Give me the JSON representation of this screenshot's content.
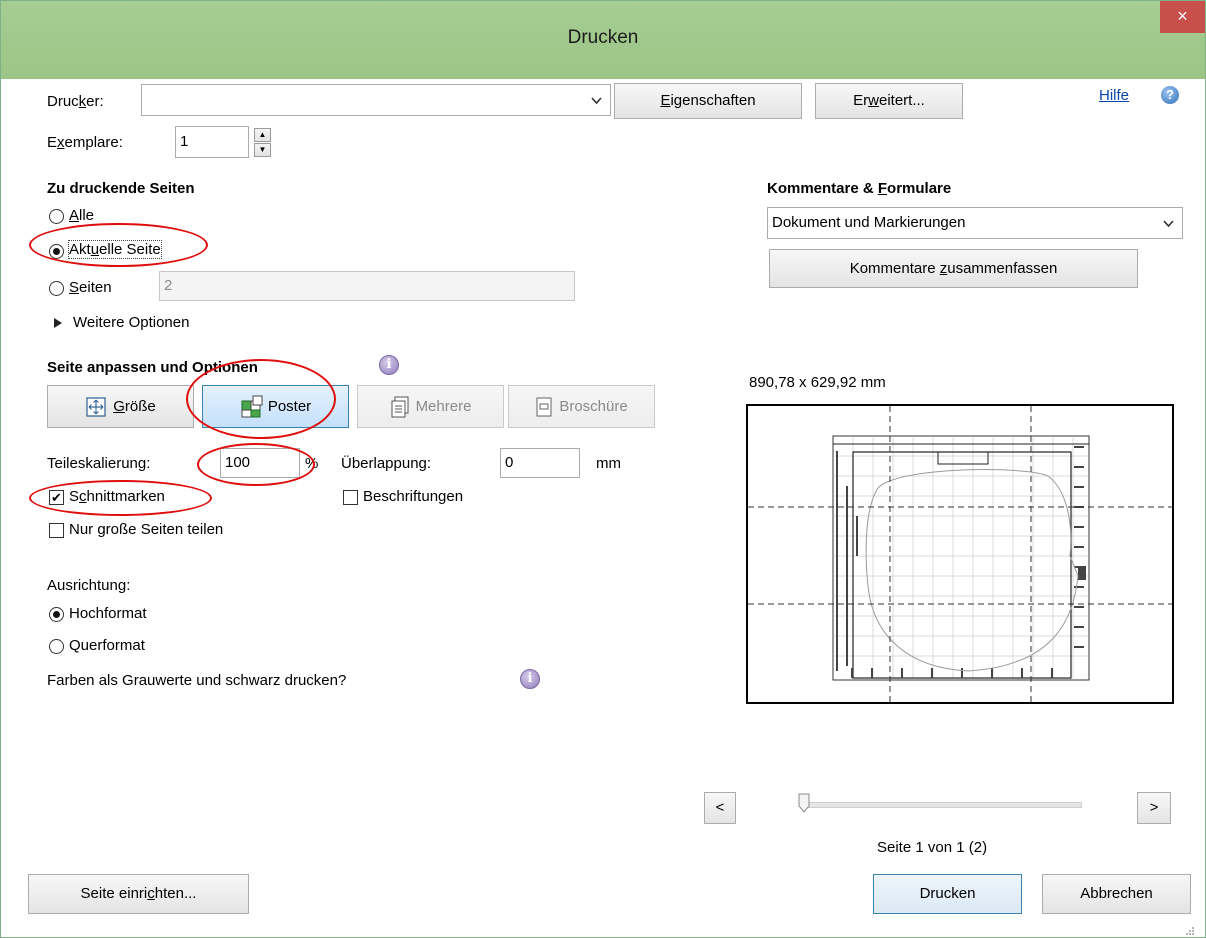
{
  "window": {
    "title": "Drucken",
    "close_glyph": "×"
  },
  "printer": {
    "label_pre": "Druc",
    "label_acc": "k",
    "label_post": "er:",
    "value": "",
    "properties_acc": "E",
    "properties_rest": "igenschaften",
    "advanced_pre": "Er",
    "advanced_acc": "w",
    "advanced_post": "eitert...",
    "help_link": "Hilfe",
    "help_icon": "help-icon"
  },
  "copies": {
    "label_pre": "E",
    "label_acc": "x",
    "label_post": "emplare:",
    "value": "1"
  },
  "pages": {
    "heading": "Zu druckende Seiten",
    "all_acc": "A",
    "all_rest": "lle",
    "current_pre": "Akt",
    "current_acc": "u",
    "current_post": "elle Seite",
    "pages_acc": "S",
    "pages_rest": "eiten",
    "pages_value": "2",
    "more_options": "Weitere Optionen",
    "selected": "current"
  },
  "fit": {
    "heading": "Seite anpassen und Optionen",
    "size_acc": "G",
    "size_rest": "röße",
    "poster": "Poster",
    "multiple": "Mehrere",
    "booklet": "Broschüre",
    "active": "poster"
  },
  "poster": {
    "tile_scale_label": "Teileskalierung:",
    "tile_scale_value": "100",
    "percent": "%",
    "overlap_label": "Überlappung:",
    "overlap_value": "0",
    "overlap_unit": "mm",
    "cut_marks_pre": "S",
    "cut_marks_acc": "c",
    "cut_marks_post": "hnittmarken",
    "cut_marks_checked": true,
    "labels": "Beschriftungen",
    "labels_checked": false,
    "large_only": "Nur große Seiten teilen",
    "large_only_checked": false
  },
  "orientation": {
    "label": "Ausrichtung:",
    "portrait": "Hochformat",
    "landscape": "Querformat",
    "selected": "portrait"
  },
  "grayscale_label": "Farben als Grauwerte und schwarz drucken?",
  "comments": {
    "heading_pre": "Kommentare & ",
    "heading_acc": "F",
    "heading_post": "ormulare",
    "value": "Dokument und Markierungen",
    "summarize_pre": "Kommentare ",
    "summarize_acc": "z",
    "summarize_post": "usammenfassen"
  },
  "preview": {
    "dimensions": "890,78 x 629,92 mm",
    "prev": "<",
    "next": ">",
    "page_status": "Seite 1 von 1 (2)",
    "slider_position": 0
  },
  "footer": {
    "setup_pre": "Seite einri",
    "setup_acc": "c",
    "setup_post": "hten...",
    "print": "Drucken",
    "cancel": "Abbrechen"
  },
  "colors": {
    "titlebar": "#a6cd93",
    "close": "#c7504a",
    "annotation": "#e00d0d",
    "link": "#0645ad"
  }
}
